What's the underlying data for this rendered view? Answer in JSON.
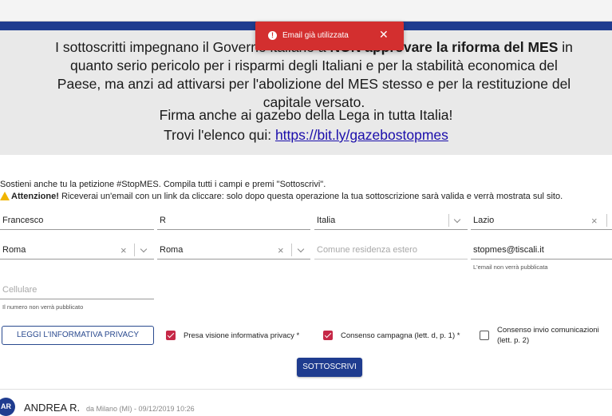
{
  "hero": {
    "line1_pre": "I sottoscritti impegnano il Governo italiano a ",
    "line1_bold": "NON approvare la riforma del MES",
    "line1_post": " in quanto serio pericolo per i risparmi degli Italiani e per la stabilità economica del Paese, ma anzi ad attivarsi per l'abolizione del MES stesso e per la restituzione del capitale versato.",
    "line2": "Firma anche ai gazebo della Lega in tutta Italia!",
    "line3_pre": "Trovi l'elenco qui: ",
    "line3_link": "https://bit.ly/gazebostopmes"
  },
  "toast": {
    "icon": "alert-circle-icon",
    "icon_glyph": "!",
    "message": "Email già utilizzata",
    "close_glyph": "✕",
    "color": "#d32f2f"
  },
  "form": {
    "intro": "Sostieni anche tu la petizione #StopMES. Compila tutti i campi e premi \"Sottoscrivi\".",
    "warning_bold": "Attenzione!",
    "warning_text": " Riceverai un'email con un link da cliccare: solo dopo questa operazione la tua sottoscrizione sarà valida e verrà mostrata sul sito.",
    "first_name": "Francesco",
    "last_name": "R",
    "country": "Italia",
    "region": "Lazio",
    "province": "Roma",
    "city": "Roma",
    "foreign_city_placeholder": "Comune residenza estero",
    "email": "stopmes@tiscali.it",
    "email_hint": "L'email non verrà pubblicata",
    "phone_placeholder": "Cellulare",
    "phone_hint": "Il numero non verrà pubblicato",
    "privacy_button": "LEGGI L'INFORMATIVA PRIVACY",
    "consent_privacy": "Presa visione informativa privacy *",
    "consent_campaign": "Consenso campagna (lett. d, p. 1) *",
    "consent_comm": "Consenso invio comunicazioni (lett. p. 2)",
    "submit": "SOTTOSCRIVI",
    "clear_glyph": "×"
  },
  "comment": {
    "initials": "AR",
    "name": "ANDREA R.",
    "meta": "da Milano (MI) - 09/12/2019 10:26"
  },
  "colors": {
    "brand_blue": "#1f3c8f",
    "checkbox_red": "#c62847"
  }
}
